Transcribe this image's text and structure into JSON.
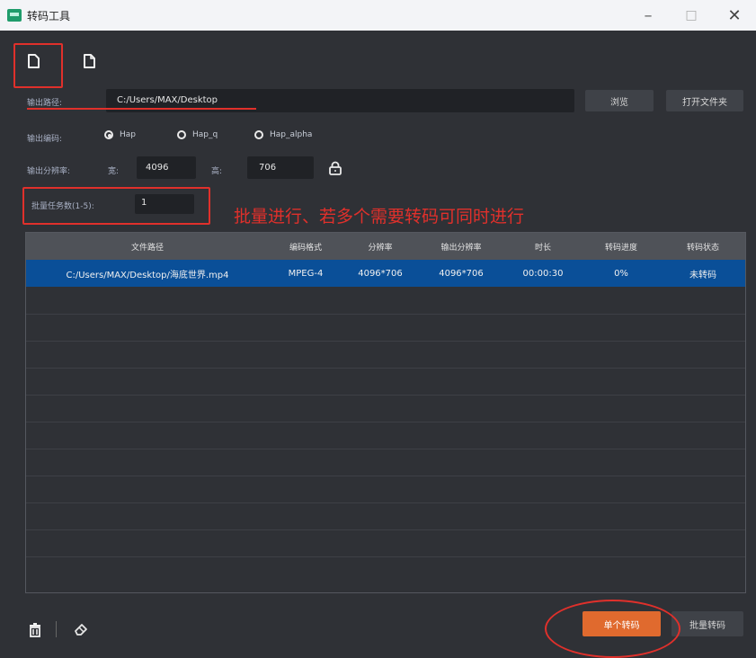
{
  "window": {
    "title": "转码工具",
    "controls": {
      "minimize": "–",
      "maximize": "□",
      "close": "✕"
    }
  },
  "toolbar": {
    "icons": [
      "file-icon",
      "file-alt-icon"
    ]
  },
  "output_path": {
    "label": "输出路径:",
    "value": "C:/Users/MAX/Desktop",
    "browse_label": "浏览",
    "open_folder_label": "打开文件夹"
  },
  "encoding": {
    "label": "输出编码:",
    "options": [
      "Hap",
      "Hap_q",
      "Hap_alpha"
    ],
    "selected": "Hap"
  },
  "resolution": {
    "label": "输出分辨率:",
    "width_label": "宽:",
    "width_value": "4096",
    "height_label": "高:",
    "height_value": "706"
  },
  "batch": {
    "label": "批量任务数(1-5):",
    "value": "1",
    "annotation": "批量进行、若多个需要转码可同时进行"
  },
  "table": {
    "columns": [
      "文件路径",
      "编码格式",
      "分辨率",
      "输出分辨率",
      "时长",
      "转码进度",
      "转码状态"
    ],
    "rows": [
      [
        "C:/Users/MAX/Desktop/海底世界.mp4",
        "MPEG-4",
        "4096*706",
        "4096*706",
        "00:00:30",
        "0%",
        "未转码"
      ]
    ]
  },
  "bottom": {
    "single_transcode_label": "单个转码",
    "batch_transcode_label": "批量转码"
  },
  "colors": {
    "accent_orange": "#e06a2e",
    "selection_blue": "#0a4f98",
    "annotation_red": "#e0302b",
    "background": "#2f3136"
  }
}
